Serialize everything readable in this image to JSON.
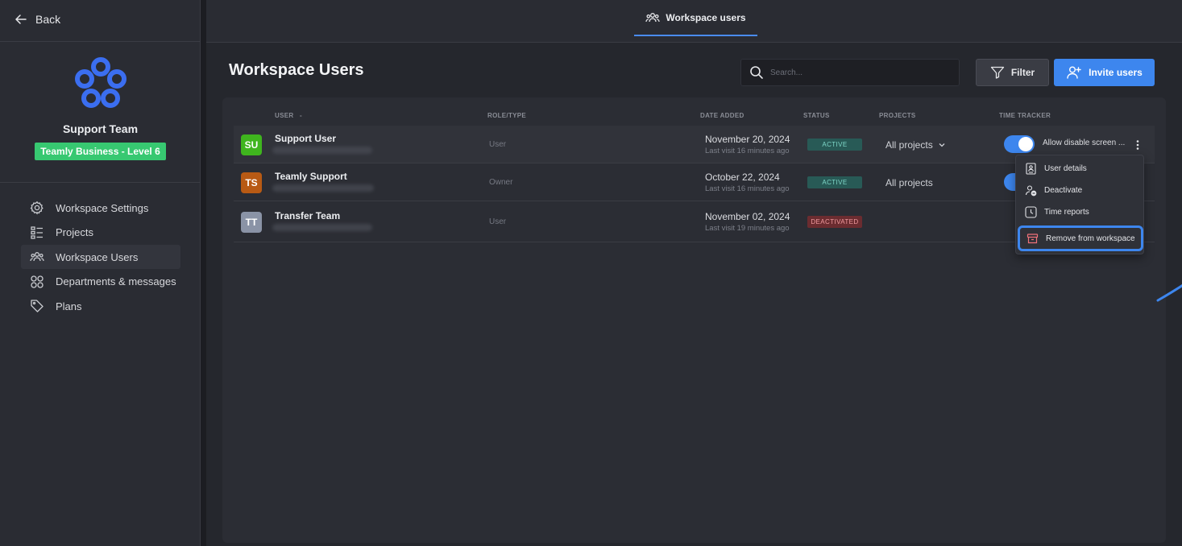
{
  "sidebar": {
    "back_label": "Back",
    "team_name": "Support Team",
    "plan_badge": "Teamly Business - Level 6",
    "items": [
      {
        "label": "Workspace Settings",
        "icon": "gear-icon"
      },
      {
        "label": "Projects",
        "icon": "list-icon"
      },
      {
        "label": "Workspace Users",
        "icon": "users-icon",
        "active": true
      },
      {
        "label": "Departments & messages",
        "icon": "grid-icon"
      },
      {
        "label": "Plans",
        "icon": "tag-icon"
      }
    ]
  },
  "header": {
    "tab_label": "Workspace users"
  },
  "main": {
    "title": "Workspace Users",
    "search_placeholder": "Search...",
    "filter_label": "Filter",
    "invite_label": "Invite users"
  },
  "table": {
    "columns": {
      "user": "USER",
      "role": "ROLE/TYPE",
      "date_added": "DATE ADDED",
      "status": "STATUS",
      "projects": "PROJECTS",
      "time_tracker": "TIME TRACKER"
    },
    "sort_indicator": "-",
    "rows": [
      {
        "initials": "SU",
        "avatar_color": "#3fb51e",
        "name": "Support User",
        "role": "User",
        "date": "November 20, 2024",
        "last_visit": "Last visit 16 minutes ago",
        "status": "ACTIVE",
        "projects": "All projects",
        "time_tracker": "Allow disable screen ..."
      },
      {
        "initials": "TS",
        "avatar_color": "#b85a14",
        "name": "Teamly Support",
        "role": "Owner",
        "date": "October 22, 2024",
        "last_visit": "Last visit 16 minutes ago",
        "status": "ACTIVE",
        "projects": "All projects"
      },
      {
        "initials": "TT",
        "avatar_color": "#8a93a6",
        "name": "Transfer Team",
        "role": "User",
        "date": "November 02, 2024",
        "last_visit": "Last visit 19 minutes ago",
        "status": "DEACTIVATED"
      }
    ]
  },
  "context_menu": {
    "items": [
      {
        "label": "User details",
        "icon": "user-details-icon"
      },
      {
        "label": "Deactivate",
        "icon": "user-minus-icon"
      },
      {
        "label": "Time reports",
        "icon": "clock-icon"
      },
      {
        "label": "Remove from workspace",
        "icon": "archive-icon",
        "highlighted": true
      }
    ]
  },
  "colors": {
    "accent": "#3d86ee",
    "badge_green": "#37c871",
    "status_active": "#7fd8c9",
    "status_deactivated": "#f29b9f",
    "archive_icon": "#f0727a"
  }
}
